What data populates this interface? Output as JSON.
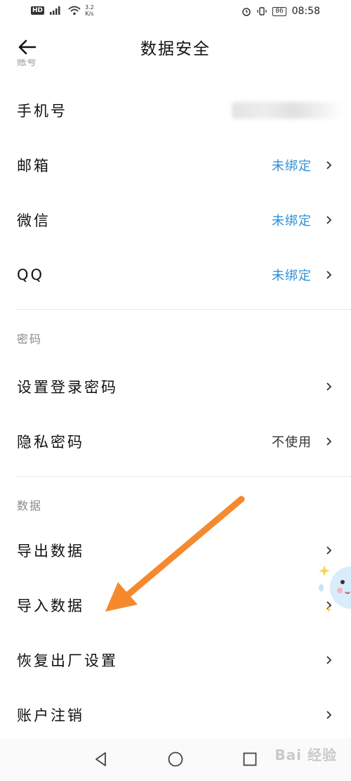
{
  "status_bar": {
    "hd": "HD",
    "signal": "5G",
    "net_speed": "3.2",
    "net_unit": "K/s",
    "battery": "86",
    "time": "08:58"
  },
  "header": {
    "title": "数据安全"
  },
  "account_section": {
    "rows": [
      {
        "label": "手机号",
        "value": ""
      },
      {
        "label": "邮箱",
        "value": "未绑定"
      },
      {
        "label": "微信",
        "value": "未绑定"
      },
      {
        "label": "QQ",
        "value": "未绑定"
      }
    ]
  },
  "password_section": {
    "title": "密码",
    "rows": [
      {
        "label": "设置登录密码",
        "value": ""
      },
      {
        "label": "隐私密码",
        "value": "不使用"
      }
    ]
  },
  "data_section": {
    "title": "数据",
    "rows": [
      {
        "label": "导出数据"
      },
      {
        "label": "导入数据"
      },
      {
        "label": "恢复出厂设置"
      },
      {
        "label": "账户注销"
      }
    ]
  },
  "watermark": "Bai 经验",
  "colors": {
    "accent_blue": "#2f8fd6",
    "annotation_orange": "#f5892e",
    "section_gray": "#8a8a8a"
  }
}
